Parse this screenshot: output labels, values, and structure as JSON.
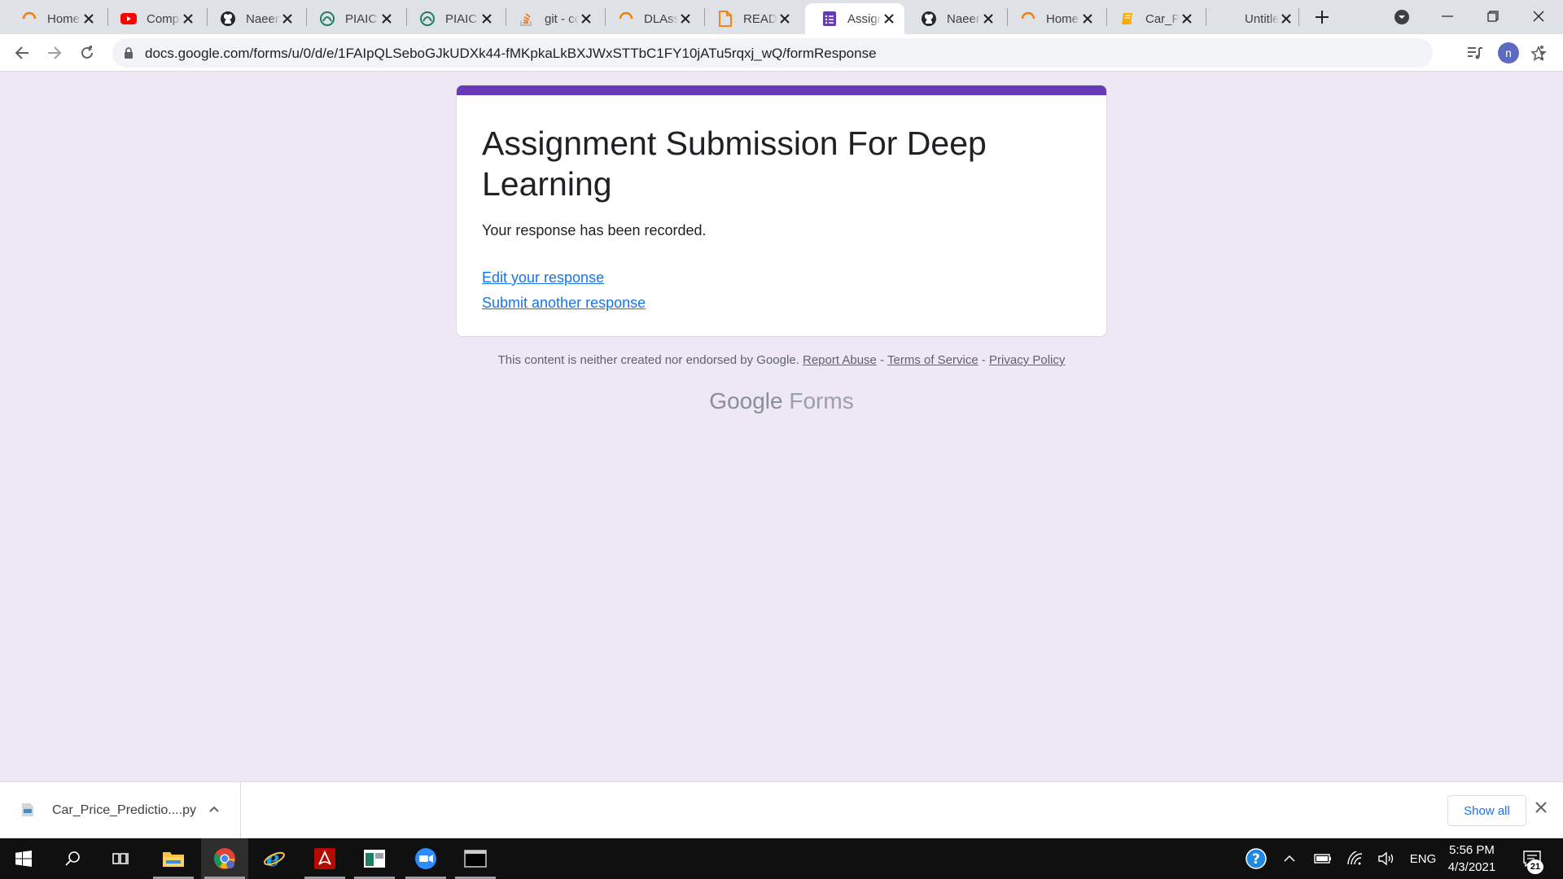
{
  "browser": {
    "tabs": [
      {
        "title": "Home",
        "icon": "circle-loader-icon",
        "active": false
      },
      {
        "title": "Compl",
        "icon": "youtube-icon",
        "active": false
      },
      {
        "title": "Naeem",
        "icon": "github-icon",
        "active": false
      },
      {
        "title": "PIAIC",
        "icon": "piaic-icon",
        "active": false
      },
      {
        "title": "PIAIC",
        "icon": "piaic-icon",
        "active": false
      },
      {
        "title": "git - co",
        "icon": "stackoverflow-icon",
        "active": false
      },
      {
        "title": "DLAss",
        "icon": "circle-loader-icon",
        "active": false
      },
      {
        "title": "READI",
        "icon": "document-icon",
        "active": false
      },
      {
        "title": "Assign",
        "icon": "google-forms-icon",
        "active": true
      },
      {
        "title": "Naeem",
        "icon": "github-icon",
        "active": false
      },
      {
        "title": "Home",
        "icon": "circle-loader-icon",
        "active": false
      },
      {
        "title": "Car_Pr",
        "icon": "colab-notebook-icon",
        "active": false
      },
      {
        "title": "Untitled",
        "icon": "blank-page-icon",
        "active": false
      }
    ],
    "url": "docs.google.com/forms/u/0/d/e/1FAIpQLSeboGJkUDXk44-fMKpkaLkBXJWxSTTbC1FY10jATu5rqxj_wQ/formResponse",
    "avatar_letter": "n"
  },
  "form": {
    "title": "Assignment Submission For Deep Learning",
    "confirmation": "Your response has been recorded.",
    "edit_link": "Edit your response",
    "submit_another_link": "Submit another response",
    "accent_color": "#673ab7"
  },
  "footer": {
    "disclaimer": "This content is neither created nor endorsed by Google.",
    "report_abuse": "Report Abuse",
    "sep": "-",
    "terms": "Terms of Service",
    "privacy": "Privacy Policy",
    "brand_google": "Google",
    "brand_forms": "Forms"
  },
  "downloads": {
    "file_name": "Car_Price_Predictio....py",
    "show_all": "Show all"
  },
  "taskbar": {
    "apps": [
      "windows-start-icon",
      "search-icon",
      "task-view-icon",
      "file-explorer-icon",
      "chrome-icon",
      "internet-explorer-icon",
      "acrobat-icon",
      "spyder-icon",
      "zoom-icon",
      "terminal-icon"
    ],
    "language": "ENG",
    "time": "5:56 PM",
    "date": "4/3/2021",
    "notification_count": "21"
  }
}
